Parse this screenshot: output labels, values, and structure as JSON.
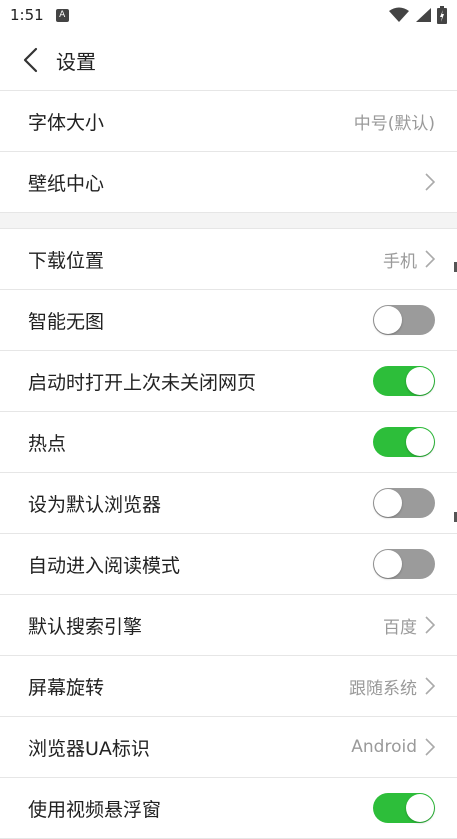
{
  "status": {
    "time": "1:51",
    "notif_letter": "A"
  },
  "appbar": {
    "title": "设置"
  },
  "colors": {
    "toggle_on": "#2dbe3a",
    "toggle_off": "#9b9b9b"
  },
  "rows": [
    {
      "label": "字体大小",
      "value": "中号(默认)"
    },
    {
      "label": "壁纸中心",
      "value": ""
    },
    {
      "label": "下载位置",
      "value": "手机"
    },
    {
      "label": "智能无图",
      "toggle": "off"
    },
    {
      "label": "启动时打开上次未关闭网页",
      "toggle": "on"
    },
    {
      "label": "热点",
      "toggle": "on"
    },
    {
      "label": "设为默认浏览器",
      "toggle": "off"
    },
    {
      "label": "自动进入阅读模式",
      "toggle": "off"
    },
    {
      "label": "默认搜索引擎",
      "value": "百度"
    },
    {
      "label": "屏幕旋转",
      "value": "跟随系统"
    },
    {
      "label": "浏览器UA标识",
      "value": "Android"
    },
    {
      "label": "使用视频悬浮窗",
      "toggle": "on"
    }
  ]
}
